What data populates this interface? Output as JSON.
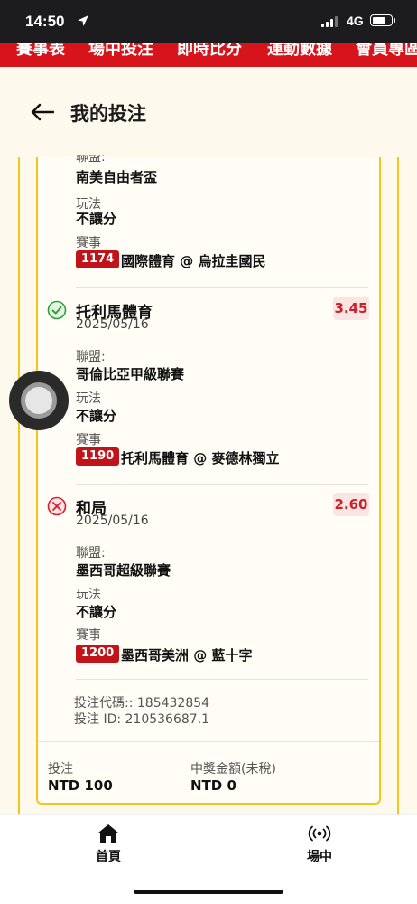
{
  "status_bar": {
    "time": "14:50",
    "network": "4G",
    "battery_level": 0.7
  },
  "top_nav": {
    "items": [
      "賽事表",
      "場中投注",
      "即時比分",
      "運動數據",
      "會員專區"
    ]
  },
  "header": {
    "title": "我的投注"
  },
  "bet": {
    "first_selection": {
      "league_label": "聯盟:",
      "league": "南美自由者盃",
      "market_label": "玩法",
      "market": "不讓分",
      "event_label": "賽事",
      "event_id": "1174",
      "event": "國際體育 @ 烏拉圭國民"
    },
    "selections": [
      {
        "name": "托利馬體育",
        "date": "2025/05/16",
        "odds": "3.45",
        "result": "won",
        "league_label": "聯盟:",
        "league": "哥倫比亞甲級聯賽",
        "market_label": "玩法",
        "market": "不讓分",
        "event_label": "賽事",
        "event_id": "1190",
        "event": "托利馬體育 @ 麥德林獨立"
      },
      {
        "name": "和局",
        "date": "2025/05/16",
        "odds": "2.60",
        "result": "lost",
        "league_label": "聯盟:",
        "league": "墨西哥超級聯賽",
        "market_label": "玩法",
        "market": "不讓分",
        "event_label": "賽事",
        "event_id": "1200",
        "event": "墨西哥美洲 @ 藍十字"
      }
    ],
    "bet_code": "投注代碼:: 185432854",
    "bet_id": "投注 ID: 210536687.1",
    "stake_label": "投注",
    "stake_value": "NTD 100",
    "payout_label": "中獎金額(未稅)",
    "payout_value": "NTD 0"
  },
  "tab_bar": {
    "items": [
      {
        "label": "首頁",
        "icon": "home-icon"
      },
      {
        "label": "場中",
        "icon": "live-icon"
      }
    ]
  },
  "colors": {
    "brand_red": "#d7141b",
    "card_border": "#f5c518",
    "won": "#2e9e3a",
    "lost": "#d81e2c",
    "odds_text": "#c8232b"
  }
}
